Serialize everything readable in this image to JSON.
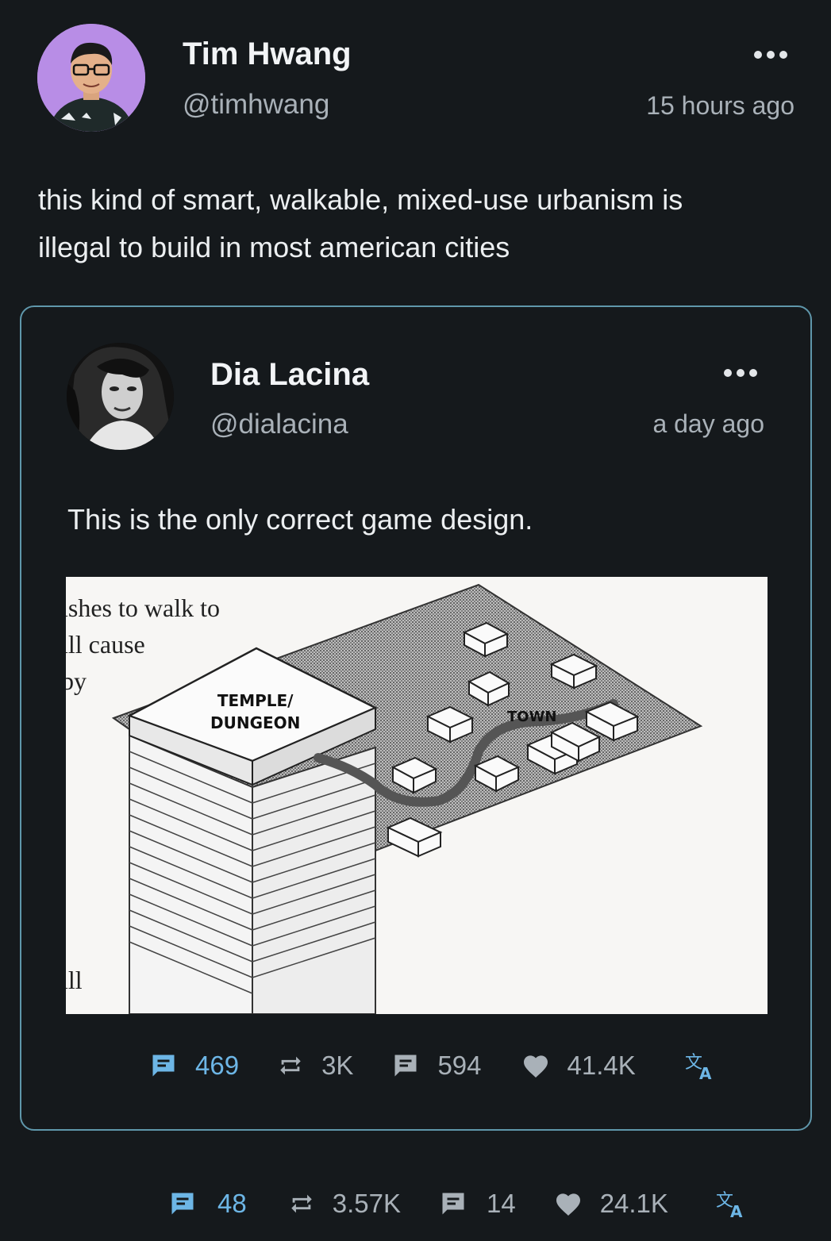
{
  "post": {
    "author_name": "Tim Hwang",
    "author_handle": "@timhwang",
    "timestamp": "15 hours ago",
    "text_line1": "this kind of smart, walkable, mixed-use urbanism is",
    "text_line2": "illegal to build in most american cities",
    "stats": {
      "comments": "48",
      "reposts": "3.57K",
      "quotes": "14",
      "likes": "24.1K"
    }
  },
  "quoted": {
    "author_name": "Dia Lacina",
    "author_handle": "@dialacina",
    "timestamp": "a day ago",
    "text": "This is the only correct game design.",
    "image": {
      "side_text": [
        "ishes to walk to",
        "ill cause",
        "by",
        "ill"
      ],
      "label_temple_line1": "TEMPLE/",
      "label_temple_line2": "DUNGEON",
      "label_town": "TOWN"
    },
    "stats": {
      "comments": "469",
      "reposts": "3K",
      "quotes": "594",
      "likes": "41.4K"
    }
  },
  "colors": {
    "background": "#15191c",
    "accent": "#6db6e6",
    "border": "#5f97ab",
    "muted": "#a9b1b8"
  }
}
